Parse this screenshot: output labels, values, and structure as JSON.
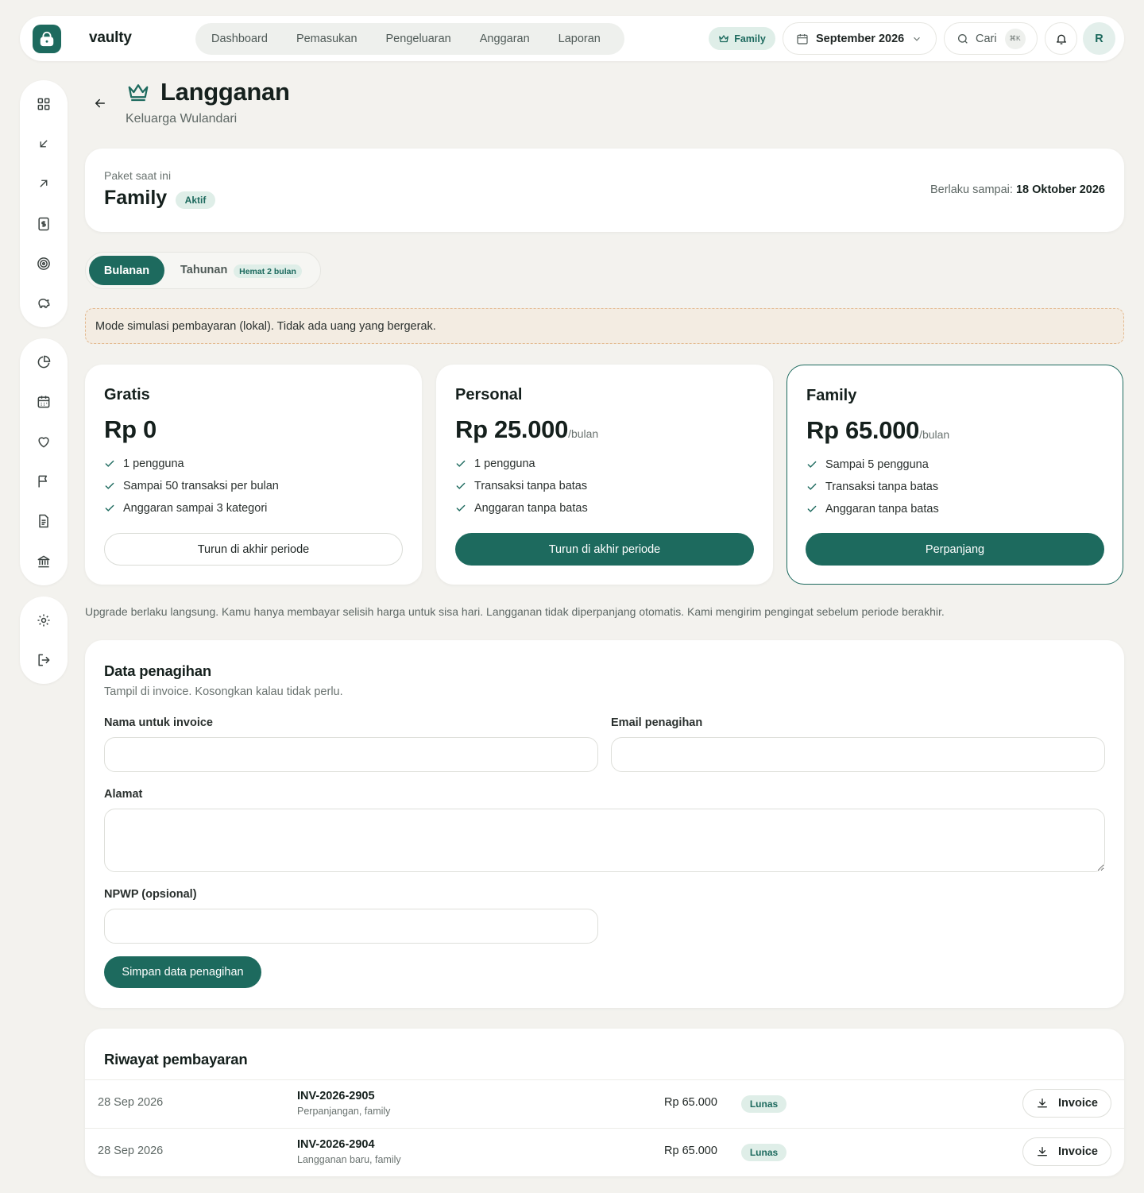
{
  "app": {
    "brand": "vaulty"
  },
  "topnav": [
    "Dashboard",
    "Pemasukan",
    "Pengeluaran",
    "Anggaran",
    "Laporan"
  ],
  "top": {
    "plan_pill": "Family",
    "month": "September 2026",
    "search_label": "Cari",
    "search_shortcut": "⌘K",
    "avatar_initial": "R"
  },
  "rail_icons_group1": [
    "dashboard-icon",
    "income-icon",
    "expense-icon",
    "budget-icon",
    "target-icon",
    "savings-icon"
  ],
  "rail_icons_group2": [
    "report-icon",
    "calendar-icon",
    "wishlist-icon",
    "goals-flag-icon",
    "document-icon",
    "bank-icon"
  ],
  "rail_icons_group3": [
    "settings-icon",
    "logout-icon"
  ],
  "header": {
    "title": "Langganan",
    "subtitle": "Keluarga Wulandari"
  },
  "current_plan": {
    "label": "Paket saat ini",
    "name": "Family",
    "status": "Aktif",
    "valid_label": "Berlaku sampai:",
    "valid_until": "18 Oktober 2026"
  },
  "billing_toggle": {
    "monthly": "Bulanan",
    "yearly": "Tahunan",
    "yearly_badge": "Hemat 2 bulan",
    "selected": "monthly"
  },
  "notice": "Mode simulasi pembayaran (lokal). Tidak ada uang yang bergerak.",
  "plans": [
    {
      "name": "Gratis",
      "price": "Rp 0",
      "period": "",
      "features": [
        "1 pengguna",
        "Sampai 50 transaksi per bulan",
        "Anggaran sampai 3 kategori"
      ],
      "button": "Turun di akhir periode",
      "button_style": "outline",
      "selected": false
    },
    {
      "name": "Personal",
      "price": "Rp 25.000",
      "period": "/bulan",
      "features": [
        "1 pengguna",
        "Transaksi tanpa batas",
        "Anggaran tanpa batas"
      ],
      "button": "Turun di akhir periode",
      "button_style": "filled",
      "selected": false
    },
    {
      "name": "Family",
      "price": "Rp 65.000",
      "period": "/bulan",
      "features": [
        "Sampai 5 pengguna",
        "Transaksi tanpa batas",
        "Anggaran tanpa batas"
      ],
      "button": "Perpanjang",
      "button_style": "filled",
      "selected": true
    }
  ],
  "footnote": "Upgrade berlaku langsung. Kamu hanya membayar selisih harga untuk sisa hari. Langganan tidak diperpanjang otomatis. Kami mengirim pengingat sebelum periode berakhir.",
  "billing": {
    "title": "Data penagihan",
    "subtitle": "Tampil di invoice. Kosongkan kalau tidak perlu.",
    "name_label": "Nama untuk invoice",
    "name_value": "",
    "email_label": "Email penagihan",
    "email_value": "",
    "address_label": "Alamat",
    "address_value": "",
    "npwp_label": "NPWP (opsional)",
    "npwp_value": "",
    "save_button": "Simpan data penagihan"
  },
  "history": {
    "title": "Riwayat pembayaran",
    "rows": [
      {
        "date": "28 Sep 2026",
        "invoice": "INV-2026-2905",
        "desc": "Perpanjangan, family",
        "amount": "Rp 65.000",
        "status": "Lunas",
        "button": "Invoice"
      },
      {
        "date": "28 Sep 2026",
        "invoice": "INV-2026-2904",
        "desc": "Langganan baru, family",
        "amount": "Rp 65.000",
        "status": "Lunas",
        "button": "Invoice"
      }
    ]
  },
  "colors": {
    "accent": "#1d6a5e",
    "accent_soft": "#dfeee8",
    "background": "#f3f2ee",
    "notice_bg": "#f3ece2",
    "notice_border": "#e3b98f"
  }
}
